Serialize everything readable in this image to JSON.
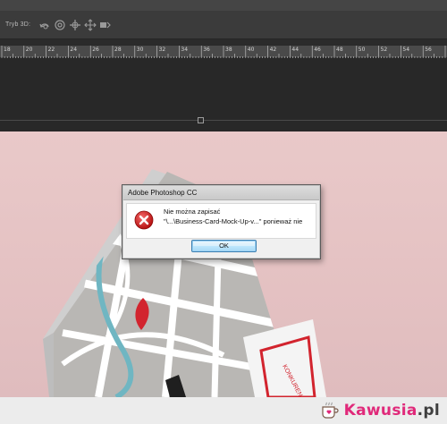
{
  "options_bar": {
    "label_3d": "Tryb 3D:",
    "tools": [
      "rotate-3d-icon",
      "roll-3d-icon",
      "pan-3d-icon",
      "slide-3d-icon",
      "scale-3d-icon"
    ]
  },
  "ruler": {
    "labels": [
      "18",
      "20",
      "22",
      "24",
      "26",
      "28",
      "30",
      "32",
      "34",
      "36",
      "38",
      "40",
      "42",
      "44",
      "46",
      "48",
      "50",
      "52",
      "54",
      "56"
    ]
  },
  "dialog": {
    "title": "Adobe Photoshop CC",
    "line1": "Nie można zapisać",
    "line2": "\"\\...\\Business-Card-Mock-Up-v...\" ponieważ nie",
    "ok_label": "OK",
    "icon": "error-icon"
  },
  "canvas": {
    "card_text": "KONKURENCYJ"
  },
  "watermark": {
    "brand_k": "K",
    "brand_rest": "awusia",
    "brand_domain": ".pl",
    "icon": "coffee-cup-icon"
  },
  "colors": {
    "error_red": "#d32020",
    "accent_pink": "#e0297a",
    "ok_blue": "#3c7fb1",
    "canvas_pink": "#e7c5c6"
  }
}
